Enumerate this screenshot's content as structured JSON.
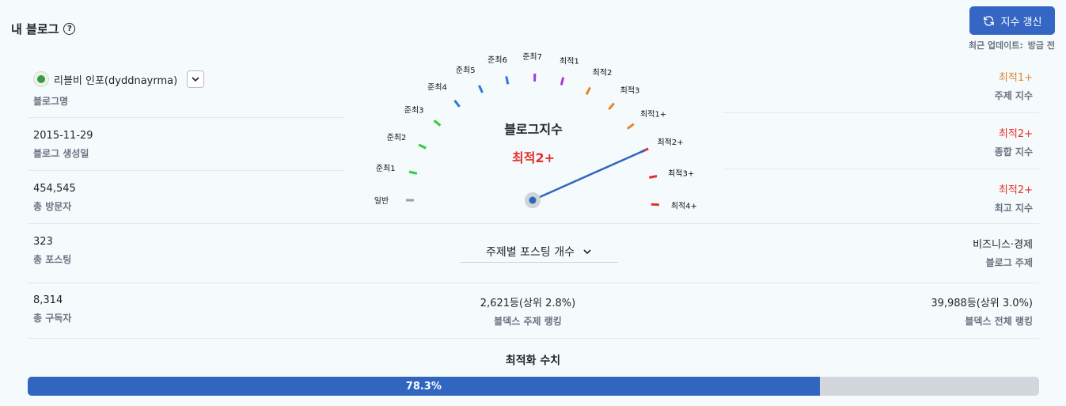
{
  "header": {
    "title": "내 블로그",
    "help_icon": "?"
  },
  "refresh": {
    "label": "지수 갱신"
  },
  "updated": {
    "label": "최근 업데이트:",
    "value": "방금 전"
  },
  "blog": {
    "name": "리블비 인포(dyddnayrma)",
    "name_label": "블로그명",
    "created": "2015-11-29",
    "created_label": "블로그 생성일",
    "visitors": "454,545",
    "visitors_label": "총 방문자",
    "posts": "323",
    "posts_label": "총 포스팅",
    "subscribers": "8,314",
    "subscribers_label": "총 구독자"
  },
  "gauge": {
    "title": "블로그지수",
    "value": "최적2+",
    "labels": [
      "일반",
      "준최1",
      "준최2",
      "준최3",
      "준최4",
      "준최5",
      "준최6",
      "준최7",
      "최적1",
      "최적2",
      "최적3",
      "최적1+",
      "최적2+",
      "최적3+",
      "최적4+"
    ],
    "tick_colors": [
      "#9aa0a6",
      "#2ecc40",
      "#2ecc40",
      "#2ecc40",
      "#2b7bd0",
      "#2b7bd0",
      "#2b7bd0",
      "#a03fdc",
      "#a03fdc",
      "#e0862f",
      "#e0862f",
      "#e0862f",
      "#e5302a",
      "#e5302a",
      "#e5302a"
    ],
    "needle_index": 12,
    "needle_color": "#3066c0"
  },
  "topic_select": {
    "label": "주제별 포스팅 개수"
  },
  "indices": {
    "topic": "최적1+",
    "topic_label": "주제 지수",
    "overall": "최적2+",
    "overall_label": "종합 지수",
    "max": "최적2+",
    "max_label": "최고 지수",
    "subject": "비즈니스·경제",
    "subject_label": "블로그 주제"
  },
  "ranking": {
    "topic_rank": "2,621등(상위 2.8%)",
    "topic_rank_label": "블덱스 주제 랭킹",
    "total_rank": "39,988등(상위 3.0%)",
    "total_rank_label": "블덱스 전체 랭킹"
  },
  "optimization": {
    "title": "최적화 수치",
    "percent": 78.3,
    "percent_label": "78.3%"
  }
}
